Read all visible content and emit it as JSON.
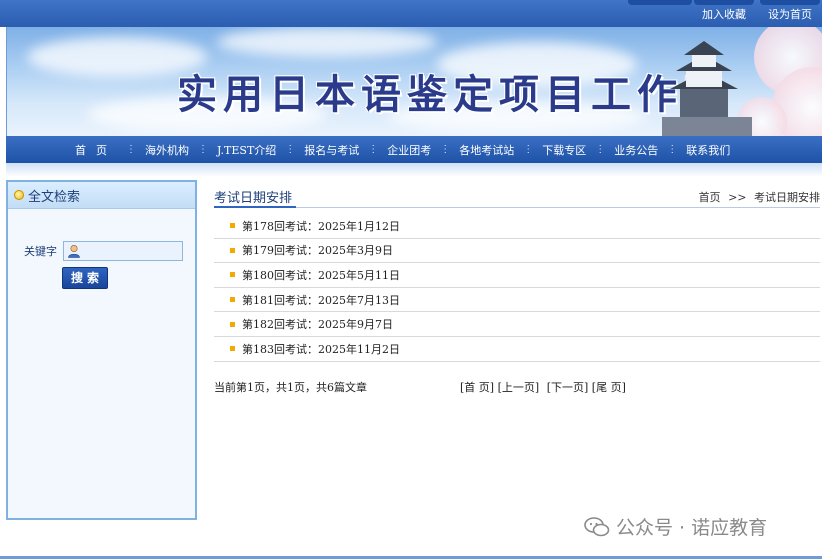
{
  "top_links": {
    "favorite": "加入收藏",
    "homepage": "设为首页"
  },
  "banner": {
    "title": "实用日本语鉴定项目工作网"
  },
  "nav": {
    "items": [
      "首页",
      "海外机构",
      "J.TEST介绍",
      "报名与考试",
      "企业团考",
      "各地考试站",
      "下载专区",
      "业务公告",
      "联系我们"
    ]
  },
  "sidebar": {
    "heading": "全文检索",
    "keyword_label": "关键字",
    "keyword_value": "",
    "search_button": "搜索"
  },
  "main": {
    "title": "考试日期安排",
    "breadcrumb": {
      "home": "首页",
      "sep": ">>",
      "current": "考试日期安排"
    },
    "list": [
      "第178回考试：2025年1月12日",
      "第179回考试：2025年3月9日",
      "第180回考试：2025年5月11日",
      "第181回考试：2025年7月13日",
      "第182回考试：2025年9月7日",
      "第183回考试：2025年11月2日"
    ],
    "pager": {
      "summary": "当前第1页，共1页，共6篇文章",
      "first": "[首 页]",
      "prev": "[上一页]",
      "next": "[下一页]",
      "last": "[尾 页]"
    }
  },
  "watermark": {
    "text": "公众号 · 诺应教育"
  },
  "colors": {
    "nav_blue": "#2b5db0",
    "accent_yellow": "#f2a900",
    "sidebar_border": "#7fb2e3"
  }
}
